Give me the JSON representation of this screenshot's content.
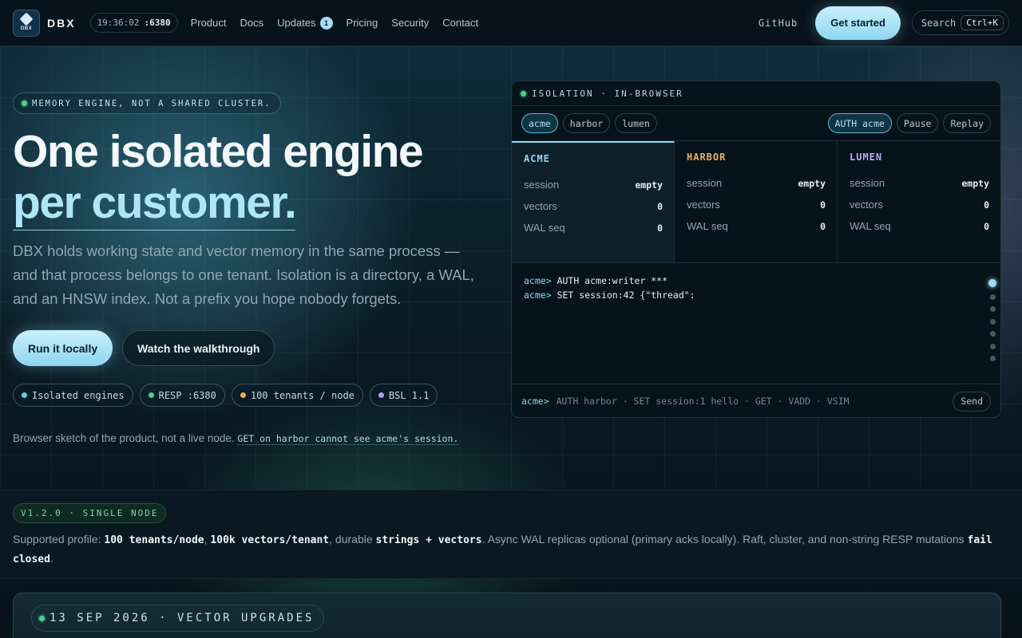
{
  "nav": {
    "brand": "DBX",
    "logo_text": "DBX",
    "clock_time": "19:36:02",
    "clock_port": ":6380",
    "links": [
      {
        "label": "Product"
      },
      {
        "label": "Docs"
      },
      {
        "label": "Updates",
        "badge": "1"
      },
      {
        "label": "Pricing"
      },
      {
        "label": "Security"
      },
      {
        "label": "Contact"
      }
    ],
    "github": "GitHub",
    "cta": "Get started",
    "search_label": "Search",
    "search_shortcut": "Ctrl+K"
  },
  "hero": {
    "eyebrow": "MEMORY ENGINE, NOT A SHARED CLUSTER.",
    "title_line1": "One isolated engine",
    "title_line2": "per customer.",
    "lede": "DBX holds working state and vector memory in the same process — and that process belongs to one tenant. Isolation is a directory, a WAL, and an HNSW index. Not a prefix you hope nobody forgets.",
    "primary_button": "Run it locally",
    "secondary_button": "Watch the walkthrough",
    "chips": [
      {
        "label": "Isolated engines",
        "color": "#5fd0f0"
      },
      {
        "label": "RESP :6380",
        "color": "#4fd08a"
      },
      {
        "label": "100 tenants / node",
        "color": "#f0a850"
      },
      {
        "label": "BSL 1.1",
        "color": "#b49cf0"
      }
    ],
    "note_text": "Browser sketch of the product, not a live node.",
    "note_code": "GET on harbor cannot see acme's session."
  },
  "panel": {
    "title": "ISOLATION · IN-BROWSER",
    "tenant_tabs": [
      "acme",
      "harbor",
      "lumen"
    ],
    "active_tab": "acme",
    "auth_button": "AUTH acme",
    "pause_button": "Pause",
    "replay_button": "Replay",
    "tenants": [
      {
        "name": "ACME",
        "color": "#8fd6f0",
        "rows": [
          [
            "session",
            "empty"
          ],
          [
            "vectors",
            "0"
          ],
          [
            "WAL seq",
            "0"
          ]
        ]
      },
      {
        "name": "HARBOR",
        "color": "#f0b060",
        "rows": [
          [
            "session",
            "empty"
          ],
          [
            "vectors",
            "0"
          ],
          [
            "WAL seq",
            "0"
          ]
        ]
      },
      {
        "name": "LUMEN",
        "color": "#c0a8f5",
        "rows": [
          [
            "session",
            "empty"
          ],
          [
            "vectors",
            "0"
          ],
          [
            "WAL seq",
            "0"
          ]
        ]
      }
    ],
    "terminal": [
      {
        "prompt": "acme>",
        "cmd": "AUTH acme:writer ***"
      },
      {
        "prompt": "acme>",
        "cmd": "SET session:42 {\"thread\":"
      }
    ],
    "input_prompt": "acme>",
    "input_placeholder": "AUTH harbor · SET session:1 hello · GET · VADD · VSIM",
    "send_button": "Send"
  },
  "version": {
    "pill": "V1.2.0 · SINGLE NODE",
    "t1": "Supported profile: ",
    "b1": "100 tenants/node",
    "t2": ", ",
    "b2": "100k vectors/tenant",
    "t3": ", durable ",
    "b3": "strings + vectors",
    "t4": ". Async WAL replicas optional (primary acks locally). Raft, cluster, and non-string RESP mutations ",
    "b4": "fail closed",
    "t5": "."
  },
  "upgrade": {
    "pill": "13 SEP 2026 · VECTOR UPGRADES"
  }
}
